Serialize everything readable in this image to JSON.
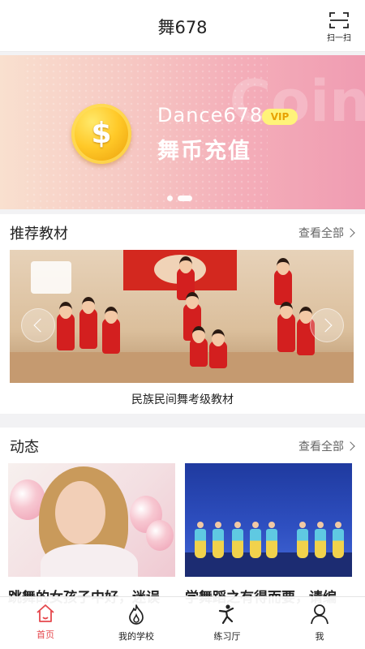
{
  "header": {
    "title": "舞678",
    "scan_label": "扫一扫"
  },
  "banner": {
    "watermark": "Coin",
    "coin_symbol": "$",
    "brand": "Dance678",
    "vip": "VIP",
    "headline": "舞币充值",
    "active_slide": 2,
    "slide_count": 2
  },
  "recommended": {
    "title": "推荐教材",
    "more": "查看全部",
    "caption": "民族民间舞考级教材"
  },
  "dynamics": {
    "title": "动态",
    "more": "查看全部",
    "items": [
      {
        "title": "跳舞的女孩子中好，迷误"
      },
      {
        "title": "学舞蹈之有得而要，请编"
      }
    ]
  },
  "tabbar": {
    "active": "首页",
    "tabs": [
      {
        "label": "首页",
        "icon": "home-icon"
      },
      {
        "label": "我的学校",
        "icon": "flame-icon"
      },
      {
        "label": "练习厅",
        "icon": "dancer-icon"
      },
      {
        "label": "我",
        "icon": "user-icon"
      }
    ]
  },
  "colors": {
    "accent": "#e5484d",
    "banner_pink": "#f09cb2",
    "vip_yellow": "#fff37a"
  }
}
